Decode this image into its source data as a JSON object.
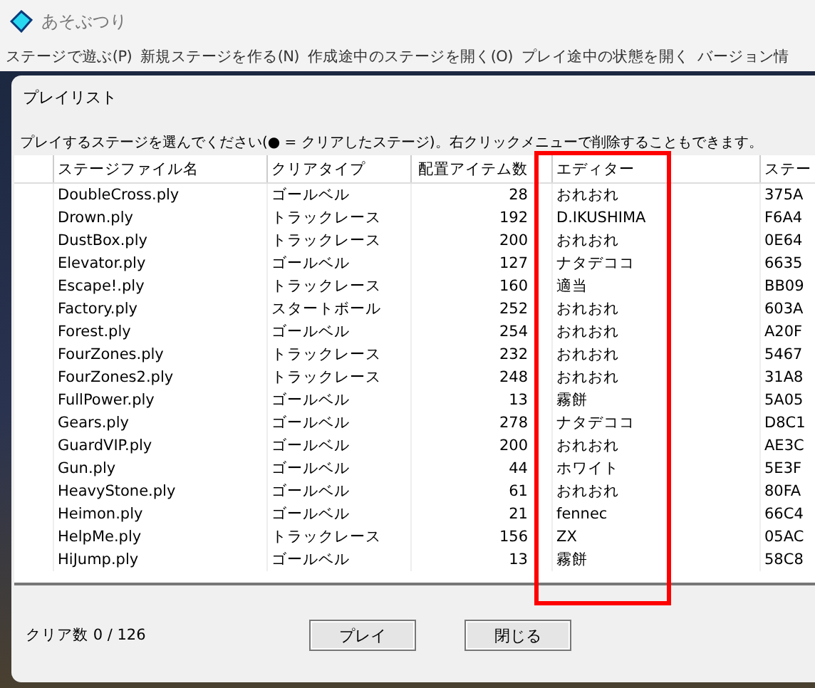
{
  "window": {
    "title": "あそぶつり"
  },
  "menu": [
    "ステージで遊ぶ(P)",
    "新規ステージを作る(N)",
    "作成途中のステージを開く(O)",
    "プレイ途中の状態を開く",
    "バージョン情"
  ],
  "dialog": {
    "title": "プレイリスト",
    "instruction": "プレイするステージを選んでください(● = クリアしたステージ)。右クリックメニューで削除することもできます。"
  },
  "table": {
    "columns": [
      "ステージファイル名",
      "クリアタイプ",
      "配置アイテム数",
      "エディター",
      "ステー"
    ],
    "rows": [
      [
        "DoubleCross.ply",
        "ゴールベル",
        "28",
        "おれおれ",
        "375A"
      ],
      [
        "Drown.ply",
        "トラックレース",
        "192",
        "D.IKUSHIMA",
        "F6A4"
      ],
      [
        "DustBox.ply",
        "トラックレース",
        "200",
        "おれおれ",
        "0E64"
      ],
      [
        "Elevator.ply",
        "ゴールベル",
        "127",
        "ナタデココ",
        "6635"
      ],
      [
        "Escape!.ply",
        "トラックレース",
        "160",
        "適当",
        "BB09"
      ],
      [
        "Factory.ply",
        "スタートボール",
        "252",
        "おれおれ",
        "603A"
      ],
      [
        "Forest.ply",
        "ゴールベル",
        "254",
        "おれおれ",
        "A20F"
      ],
      [
        "FourZones.ply",
        "トラックレース",
        "232",
        "おれおれ",
        "5467"
      ],
      [
        "FourZones2.ply",
        "トラックレース",
        "248",
        "おれおれ",
        "31A8"
      ],
      [
        "FullPower.ply",
        "ゴールベル",
        "13",
        "霧餅",
        "5A05"
      ],
      [
        "Gears.ply",
        "ゴールベル",
        "278",
        "ナタデココ",
        "D8C1"
      ],
      [
        "GuardVIP.ply",
        "ゴールベル",
        "200",
        "おれおれ",
        "AE3C"
      ],
      [
        "Gun.ply",
        "ゴールベル",
        "44",
        "ホワイト",
        "5E3F"
      ],
      [
        "HeavyStone.ply",
        "ゴールベル",
        "61",
        "おれおれ",
        "80FA"
      ],
      [
        "Heimon.ply",
        "ゴールベル",
        "21",
        "fennec",
        "66C4"
      ],
      [
        "HelpMe.ply",
        "トラックレース",
        "156",
        "ZX",
        "05AC"
      ],
      [
        "HiJump.ply",
        "ゴールベル",
        "13",
        "霧餅",
        "58C8"
      ]
    ]
  },
  "status": "クリア数 0 / 126",
  "buttons": [
    "プレイ",
    "閉じる"
  ]
}
